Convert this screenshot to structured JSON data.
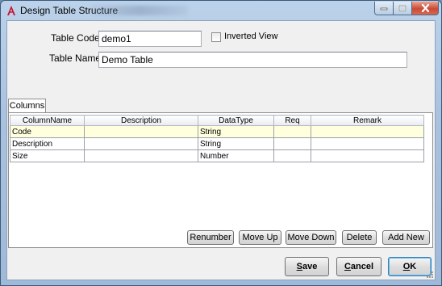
{
  "window": {
    "title": "Design Table Structure",
    "app_icon": "autocad-a-icon"
  },
  "form": {
    "table_code_label": "Table Code",
    "table_code_value": "demo1",
    "inverted_view_label": "Inverted View",
    "inverted_view_checked": false,
    "table_name_label": "Table Name",
    "table_name_value": "Demo Table"
  },
  "tabs": [
    {
      "label": "Columns",
      "active": true
    }
  ],
  "grid": {
    "headers": [
      "ColumnName",
      "Description",
      "DataType",
      "Req",
      "Remark"
    ],
    "rows": [
      [
        "Code",
        "",
        "String",
        "",
        ""
      ],
      [
        "Description",
        "",
        "String",
        "",
        ""
      ],
      [
        "Size",
        "",
        "Number",
        "",
        ""
      ]
    ],
    "selected_row": 0
  },
  "grid_buttons": {
    "renumber": "Renumber",
    "move_up": "Move Up",
    "move_down": "Move Down",
    "delete": "Delete",
    "add_new": "Add New"
  },
  "dialog_buttons": {
    "save_first": "S",
    "save_rest": "ave",
    "cancel_first": "C",
    "cancel_rest": "ancel",
    "ok_first": "O",
    "ok_rest": "K"
  },
  "colors": {
    "selected_row": "#ffffde",
    "close_button": "#c94a34",
    "icon_red": "#c8102e"
  }
}
